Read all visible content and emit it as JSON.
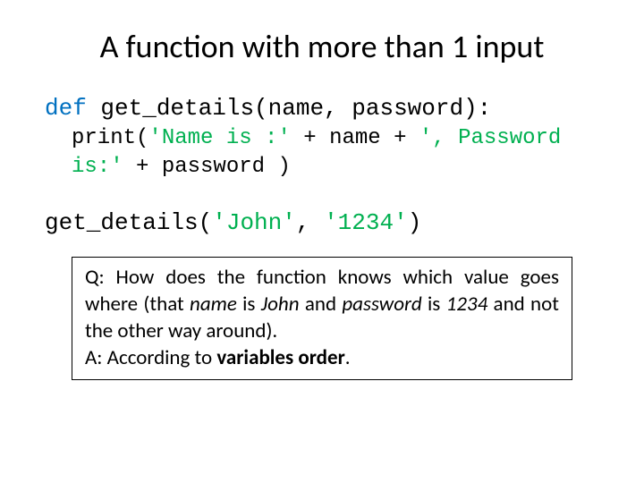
{
  "title": "A function with more than 1 input",
  "code": {
    "def_keyword": "def",
    "fn_sig": " get_details(name, password):",
    "print_prefix": "print(",
    "str1": "'Name is :'",
    "plus1": " + name + ",
    "str2": "', Password is:'",
    "plus2": " + password )",
    "call_prefix": "get_details(",
    "arg1": "'John'",
    "comma": ", ",
    "arg2": "'1234'",
    "call_suffix": ")"
  },
  "qa": {
    "q_label": "Q: ",
    "q_text1": "How does the function knows which value goes where (that ",
    "q_name": "name",
    "q_is1": " is ",
    "q_john": "John",
    "q_and": " and ",
    "q_password": "password",
    "q_is2": " is ",
    "q_1234": "1234",
    "q_text2": " and not the other way around).",
    "a_label": "A: ",
    "a_text1": "According to ",
    "a_bold": "variables order",
    "a_text2": "."
  }
}
